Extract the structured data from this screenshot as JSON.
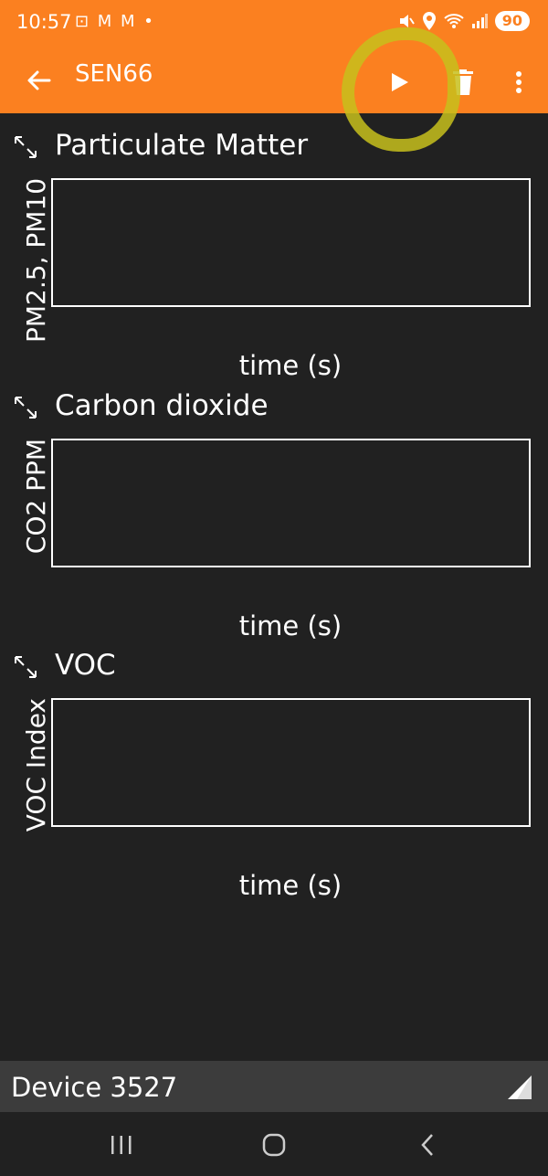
{
  "status_bar": {
    "time": "10:57",
    "left_icons": "⊡ M M •",
    "battery": "90"
  },
  "app_bar": {
    "title": "SEN66",
    "background_color": "#fb8020"
  },
  "charts": [
    {
      "title": "Particulate Matter",
      "ylabel": "PM2.5, PM10",
      "xlabel": "time (s)"
    },
    {
      "title": "Carbon dioxide",
      "ylabel": "CO2 PPM",
      "xlabel": "time (s)"
    },
    {
      "title": "VOC",
      "ylabel": "VOC Index",
      "xlabel": "time (s)"
    }
  ],
  "device_bar": {
    "device_name": "Device 3527"
  },
  "icons": {
    "back": "arrow-left-icon",
    "play": "play-icon",
    "delete": "trash-icon",
    "menu": "more-vert-icon",
    "expand": "expand-icon",
    "signal": "signal-icon"
  }
}
